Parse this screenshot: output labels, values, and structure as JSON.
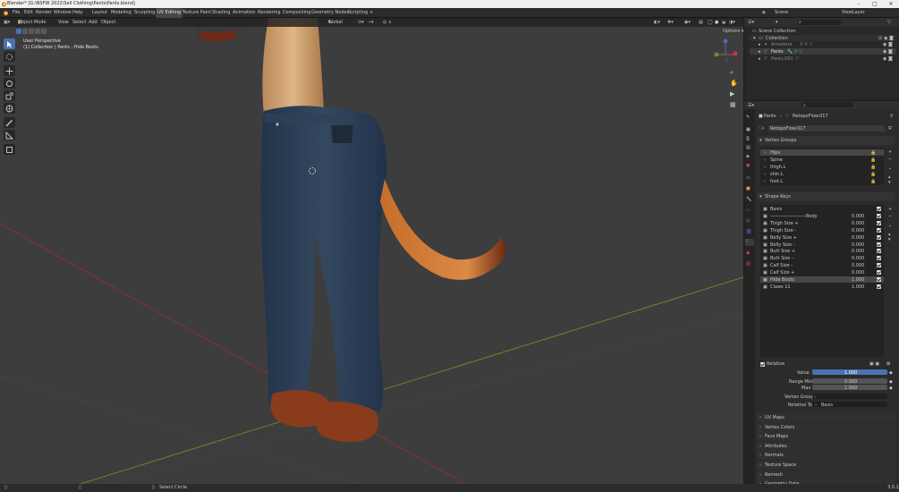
{
  "titlebar": {
    "title": "Blender* [G:\\NSFW 2022\\Sell Clothing\\Pants\\Pants.blend]",
    "minimize": "–",
    "maximize": "□",
    "close": "✕"
  },
  "menu": {
    "file": "File",
    "edit": "Edit",
    "render": "Render",
    "window": "Window",
    "help": "Help"
  },
  "workspaces": [
    "Layout",
    "Modeling",
    "Sculpting",
    "UV Editing",
    "Texture Paint",
    "Shading",
    "Animation",
    "Rendering",
    "Compositing",
    "Geometry Nodes",
    "Scripting"
  ],
  "workspace_add": "+",
  "scene": {
    "label": "Scene",
    "view_layer": "ViewLayer"
  },
  "viewport": {
    "mode": "Object Mode",
    "menus": [
      "View",
      "Select",
      "Add",
      "Object"
    ],
    "orientation": "Global",
    "options": "Options",
    "view_name": "User Perspective",
    "view_context": "(1) Collection | Pants : Hide Boots"
  },
  "outliner": {
    "scene_collection": "Scene Collection",
    "collection": "Collection",
    "items": [
      "Armature",
      "Pants",
      "Pants.001"
    ]
  },
  "properties": {
    "breadcrumb_object": "Pants",
    "breadcrumb_mesh": "RetopoFlow.017",
    "mesh_name": "RetopoFlow.017",
    "vertex_groups_title": "Vertex Groups",
    "vertex_groups": [
      "Hips",
      "Spine",
      "thigh.L",
      "shin.L",
      "foot.L"
    ],
    "shape_keys_title": "Shape Keys",
    "shape_keys": [
      {
        "name": "Basis",
        "value": ""
      },
      {
        "name": "————————Body",
        "value": "0.000"
      },
      {
        "name": "Thigh Size +",
        "value": "0.000"
      },
      {
        "name": "Thigh Size -",
        "value": "0.000"
      },
      {
        "name": "Belly Size +",
        "value": "0.000"
      },
      {
        "name": "Belly Size -",
        "value": "0.000"
      },
      {
        "name": "Butt Size +",
        "value": "0.000"
      },
      {
        "name": "Butt Size -",
        "value": "0.000"
      },
      {
        "name": "Calf Size -",
        "value": "0.000"
      },
      {
        "name": "Calf Size +",
        "value": "0.000"
      },
      {
        "name": "Hide Boots",
        "value": "1.000"
      },
      {
        "name": "Claws 11",
        "value": "1.000"
      }
    ],
    "relative": "Relative",
    "value_label": "Value",
    "value": "1.000",
    "range_min_label": "Range Min",
    "range_min": "0.000",
    "max_label": "Max",
    "max": "1.000",
    "vertex_group_label": "Vertex Group",
    "relative_to_label": "Relative To",
    "relative_to": "Basis",
    "collapsed_panels": [
      "UV Maps",
      "Vertex Colors",
      "Face Maps",
      "Attributes",
      "Normals",
      "Texture Space",
      "Remesh",
      "Geometry Data"
    ]
  },
  "statusbar": {
    "select": "Select Circle",
    "version": "3.0.1"
  },
  "colors": {
    "accent": "#4772b3",
    "viewport_bg": "#3d3d3d",
    "panel_bg": "#2b2b2b",
    "x_axis": "#a83040",
    "y_axis": "#7e9a2a"
  }
}
